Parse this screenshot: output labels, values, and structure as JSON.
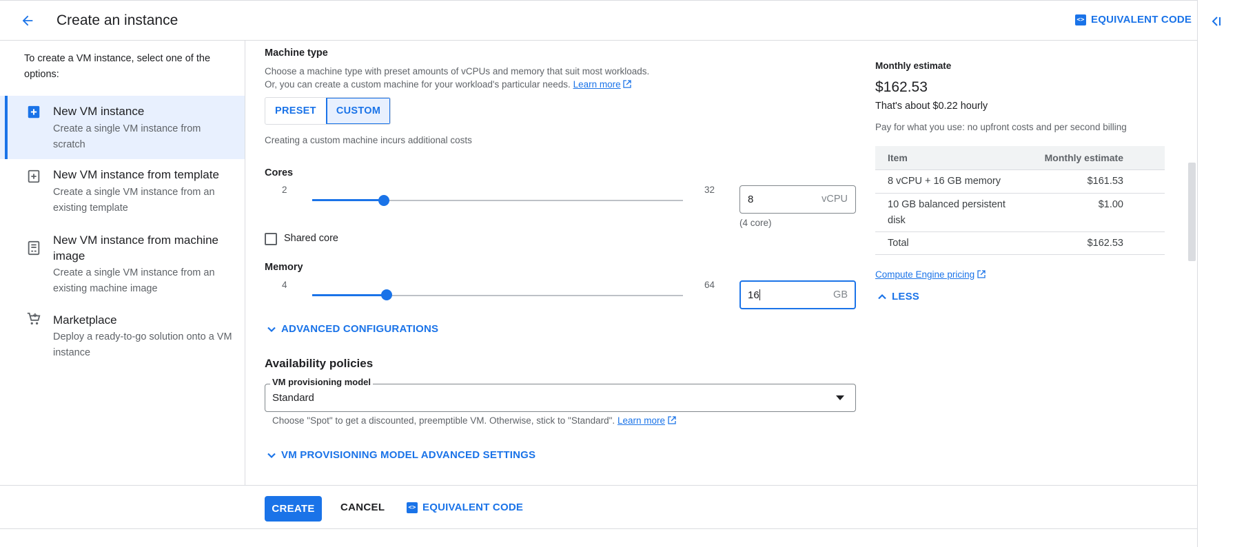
{
  "header": {
    "title": "Create an instance",
    "equivalent_code": "EQUIVALENT CODE",
    "code_icon": "code-icon"
  },
  "left": {
    "intro": "To create a VM instance, select one of the options:",
    "options": [
      {
        "title": "New VM instance",
        "desc": "Create a single VM instance from scratch",
        "icon": "add-box-icon",
        "selected": true
      },
      {
        "title": "New VM instance from template",
        "desc": "Create a single VM instance from an existing template",
        "icon": "template-add-icon",
        "selected": false
      },
      {
        "title": "New VM instance from machine image",
        "desc": "Create a single VM instance from an existing machine image",
        "icon": "machine-image-icon",
        "selected": false
      },
      {
        "title": "Marketplace",
        "desc": "Deploy a ready-to-go solution onto a VM instance",
        "icon": "cart-icon",
        "selected": false
      }
    ]
  },
  "machine_type": {
    "label": "Machine type",
    "desc_line1": "Choose a machine type with preset amounts of vCPUs and memory that suit most workloads.",
    "desc_line2": "Or, you can create a custom machine for your workload's particular needs.",
    "learn_more": "Learn more",
    "preset_label": "PRESET",
    "custom_label": "CUSTOM",
    "custom_note": "Creating a custom machine incurs additional costs"
  },
  "cores": {
    "label": "Cores",
    "min": "2",
    "max": "32",
    "value": "8",
    "unit": "vCPU",
    "note": "(4 core)",
    "slider_fraction": 0.1935
  },
  "shared_core": {
    "label": "Shared core",
    "checked": false
  },
  "memory": {
    "label": "Memory",
    "min": "4",
    "max": "64",
    "value": "16",
    "unit": "GB",
    "slider_fraction": 0.2
  },
  "advanced_configurations": "ADVANCED CONFIGURATIONS",
  "availability": {
    "heading": "Availability policies",
    "select_label": "VM provisioning model",
    "select_value": "Standard",
    "hint": "Choose \"Spot\" to get a discounted, preemptible VM. Otherwise, stick to \"Standard\".",
    "learn_more": "Learn more",
    "advanced_settings": "VM PROVISIONING MODEL ADVANCED SETTINGS"
  },
  "footer": {
    "create": "CREATE",
    "cancel": "CANCEL",
    "equivalent_code": "EQUIVALENT CODE"
  },
  "estimate": {
    "heading": "Monthly estimate",
    "amount": "$162.53",
    "hourly": "That's about $0.22 hourly",
    "note": "Pay for what you use: no upfront costs and per second billing",
    "table": {
      "col_item": "Item",
      "col_estimate": "Monthly estimate",
      "rows": [
        {
          "item": "8 vCPU + 16 GB memory",
          "cost": "$161.53"
        },
        {
          "item": "10 GB balanced persistent disk",
          "cost": "$1.00"
        },
        {
          "item": "Total",
          "cost": "$162.53"
        }
      ]
    },
    "pricing_link": "Compute Engine pricing",
    "less": "LESS"
  },
  "colors": {
    "accent": "#1a73e8",
    "selected_bg": "#e8f0fe"
  }
}
